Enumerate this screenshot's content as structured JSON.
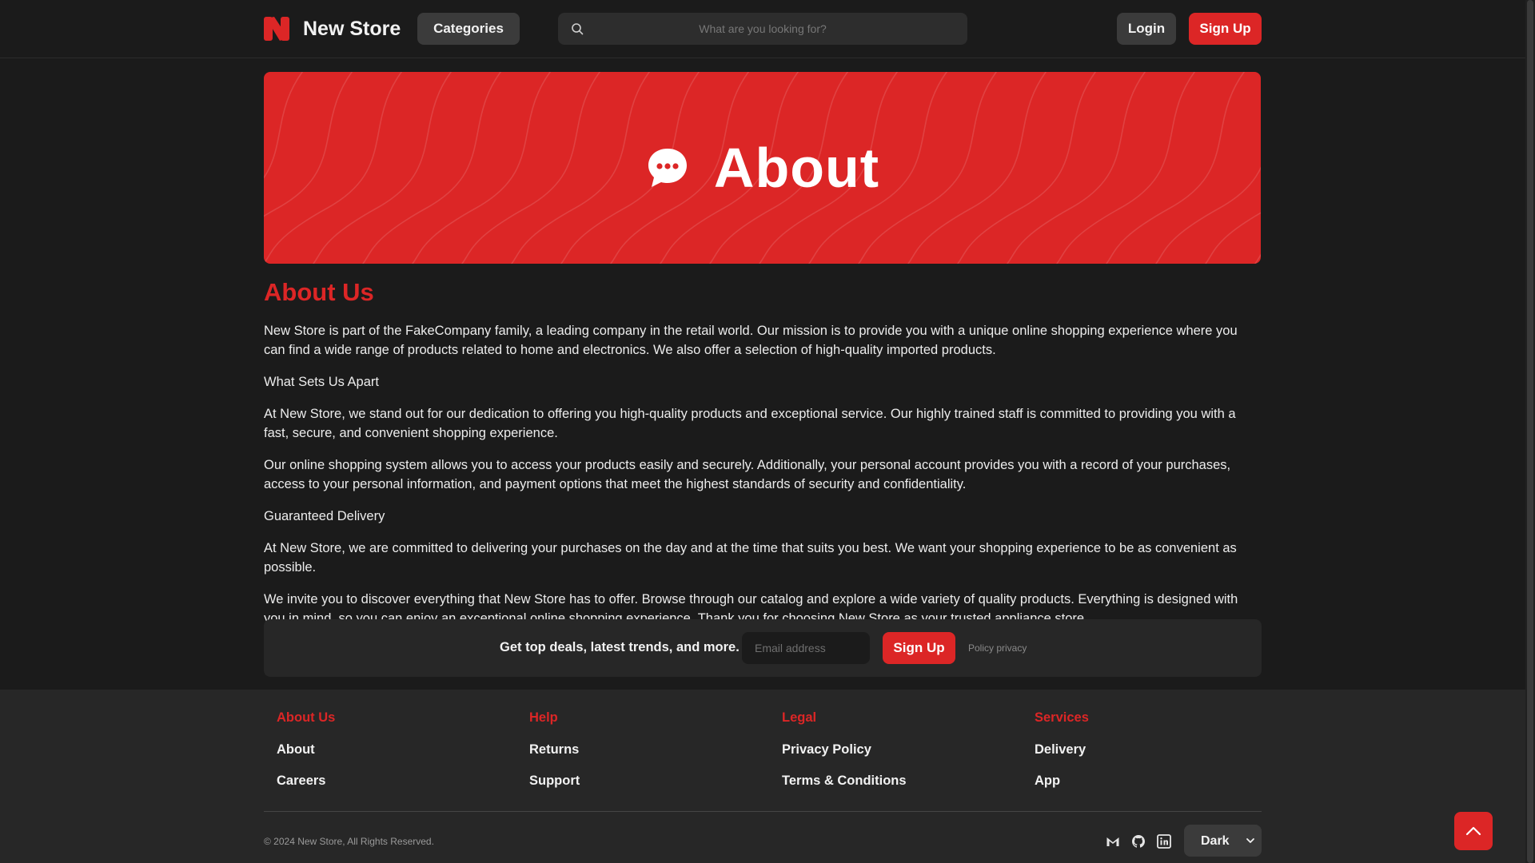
{
  "header": {
    "brand": "New Store",
    "categories_label": "Categories",
    "search_placeholder": "What are you looking for?",
    "login_label": "Login",
    "signup_label": "Sign Up"
  },
  "hero": {
    "title": "About"
  },
  "article": {
    "heading": "About Us",
    "paragraphs": [
      "New Store is part of the FakeCompany family, a leading company in the retail world. Our mission is to provide you with a unique online shopping experience where you can find a wide range of products related to home and electronics. We also offer a selection of high-quality imported products.",
      "What Sets Us Apart",
      "At New Store, we stand out for our dedication to offering you high-quality products and exceptional service. Our highly trained staff is committed to providing you with a fast, secure, and convenient shopping experience.",
      "Our online shopping system allows you to access your products easily and securely. Additionally, your personal account provides you with a record of your purchases, access to your personal information, and payment options that meet the highest standards of security and confidentiality.",
      "Guaranteed Delivery",
      "At New Store, we are committed to delivering your purchases on the day and at the time that suits you best. We want your shopping experience to be as convenient as possible.",
      "We invite you to discover everything that New Store has to offer. Browse through our catalog and explore a wide variety of quality products. Everything is designed with you in mind, so you can enjoy an exceptional online shopping experience. Thank you for choosing New Store as your trusted appliance store"
    ]
  },
  "newsletter": {
    "text": "Get top deals, latest trends, and more.",
    "email_placeholder": "Email address",
    "button_label": "Sign Up",
    "policy_label": "Policy privacy"
  },
  "footer": {
    "columns": [
      {
        "heading": "About Us",
        "links": [
          "About",
          "Careers"
        ]
      },
      {
        "heading": "Help",
        "links": [
          "Returns",
          "Support"
        ]
      },
      {
        "heading": "Legal",
        "links": [
          "Privacy Policy",
          "Terms & Conditions"
        ]
      },
      {
        "heading": "Services",
        "links": [
          "Delivery",
          "App"
        ]
      }
    ],
    "copyright": "© 2024 New Store, All Rights Reserved.",
    "social_icons": [
      "gmail-icon",
      "github-icon",
      "linkedin-icon"
    ],
    "theme_value": "Dark"
  },
  "colors": {
    "accent": "#dc2626",
    "background": "#1b1b1b",
    "surface": "#272727",
    "button_dark": "#3b3b3b"
  }
}
